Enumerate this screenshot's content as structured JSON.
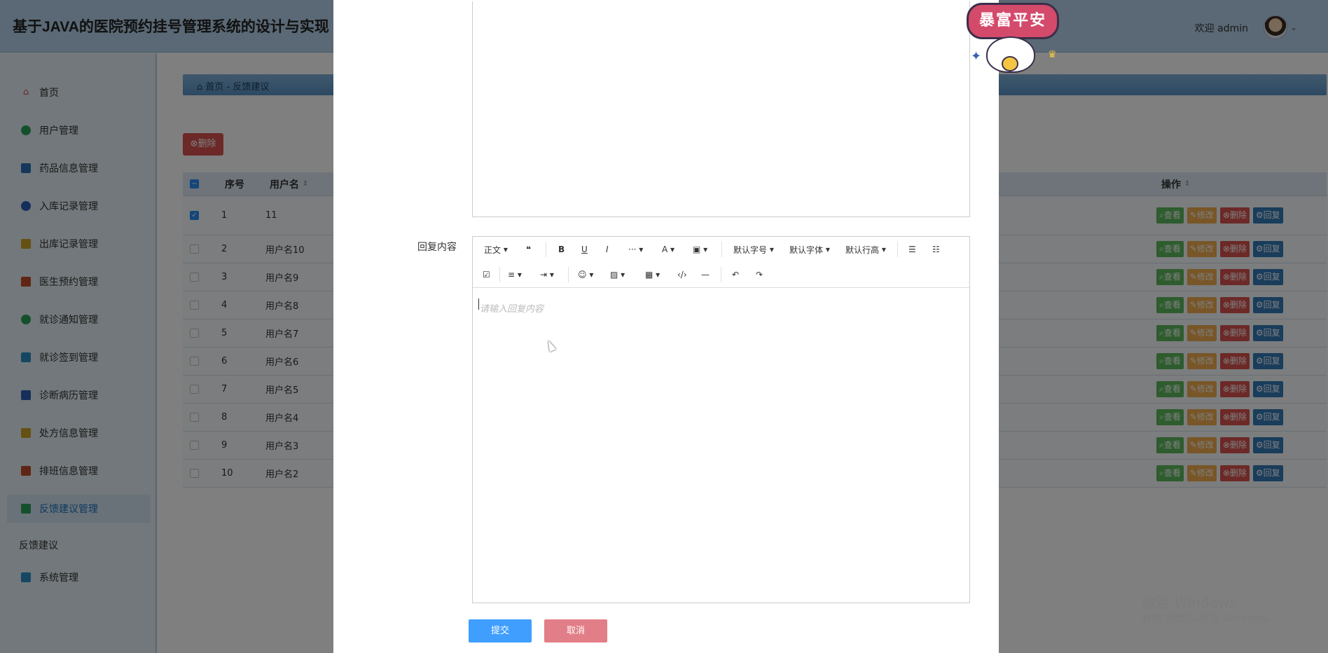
{
  "header": {
    "title": "基于JAVA的医院预约挂号管理系统的设计与实现",
    "welcome": "欢迎 admin"
  },
  "sidebar": {
    "items": [
      {
        "label": "首页",
        "icon": "home-icon",
        "color": "#d9534f"
      },
      {
        "label": "用户管理",
        "icon": "user-icon",
        "color": "#2aa15a"
      },
      {
        "label": "药品信息管理",
        "icon": "pill-icon",
        "color": "#2a6fb8"
      },
      {
        "label": "入库记录管理",
        "icon": "grid-icon",
        "color": "#2a5fb8"
      },
      {
        "label": "出库记录管理",
        "icon": "chart-icon",
        "color": "#c9a227"
      },
      {
        "label": "医生预约管理",
        "icon": "doctor-icon",
        "color": "#c14b2a"
      },
      {
        "label": "就诊通知管理",
        "icon": "circle-icon",
        "color": "#2aa15a"
      },
      {
        "label": "就诊签到管理",
        "icon": "checkin-icon",
        "color": "#2a8ec9"
      },
      {
        "label": "诊断病历管理",
        "icon": "record-icon",
        "color": "#2a5fb8"
      },
      {
        "label": "处方信息管理",
        "icon": "prescription-icon",
        "color": "#c9a227"
      },
      {
        "label": "排班信息管理",
        "icon": "schedule-icon",
        "color": "#c14b2a"
      },
      {
        "label": "反馈建议管理",
        "icon": "feedback-icon",
        "color": "#2aa15a"
      }
    ],
    "sub_item": "反馈建议",
    "last_item": {
      "label": "系统管理",
      "icon": "settings-icon",
      "color": "#2a8ec9"
    }
  },
  "content": {
    "breadcrumb_home": "首页",
    "breadcrumb_sep": "-",
    "breadcrumb_current": "反馈建议",
    "delete_button": "删除",
    "table": {
      "headers": {
        "index": "序号",
        "username": "用户名",
        "actions": "操作"
      },
      "rows": [
        {
          "index": "1",
          "username": "11",
          "checked": true
        },
        {
          "index": "2",
          "username": "用户名10",
          "checked": false
        },
        {
          "index": "3",
          "username": "用户名9",
          "checked": false
        },
        {
          "index": "4",
          "username": "用户名8",
          "checked": false
        },
        {
          "index": "5",
          "username": "用户名7",
          "checked": false
        },
        {
          "index": "6",
          "username": "用户名6",
          "checked": false
        },
        {
          "index": "7",
          "username": "用户名5",
          "checked": false
        },
        {
          "index": "8",
          "username": "用户名4",
          "checked": false
        },
        {
          "index": "9",
          "username": "用户名3",
          "checked": false
        },
        {
          "index": "10",
          "username": "用户名2",
          "checked": false
        }
      ],
      "row_actions": {
        "view": "查看",
        "edit": "修改",
        "delete": "删除",
        "reply": "回复"
      }
    }
  },
  "modal": {
    "reply_label": "回复内容",
    "toolbar": {
      "paragraph": "正文",
      "font_size": "默认字号",
      "font_family": "默认字体",
      "line_height": "默认行高"
    },
    "placeholder": "请输入回复内容",
    "submit": "提交",
    "cancel": "取消"
  },
  "sticker": {
    "text": "暴富平安"
  },
  "watermark": {
    "title": "激活 Windows",
    "subtitle": "转到\"设置\"以激活 Windows。"
  },
  "colors": {
    "header_bg": "#b4d2ea",
    "primary": "#409eff",
    "danger": "#d9534f",
    "success": "#5cb85c",
    "warning": "#f0ad4e",
    "info": "#337ab7"
  }
}
